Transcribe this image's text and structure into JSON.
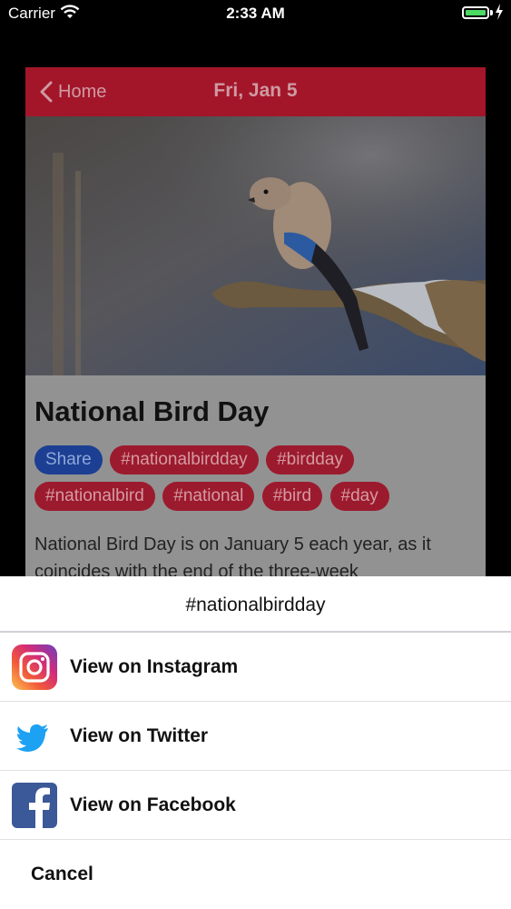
{
  "status_bar": {
    "carrier": "Carrier",
    "time": "2:33 AM",
    "battery_color": "#4cd964"
  },
  "nav": {
    "back_label": "Home",
    "title": "Fri, Jan 5"
  },
  "article": {
    "headline": "National Bird Day",
    "share_label": "Share",
    "tags": [
      "#nationalbirdday",
      "#birdday",
      "#nationalbird",
      "#national",
      "#bird",
      "#day"
    ],
    "description": "National Bird Day is on January 5 each year, as it coincides with the end of the three-week"
  },
  "action_sheet": {
    "title": "#nationalbirdday",
    "actions": [
      {
        "label": "View on Instagram",
        "icon": "instagram-icon"
      },
      {
        "label": "View on Twitter",
        "icon": "twitter-icon"
      },
      {
        "label": "View on Facebook",
        "icon": "facebook-icon"
      }
    ],
    "cancel_label": "Cancel"
  },
  "colors": {
    "nav_bar": "#a3162a",
    "tag": "#9c1a2d",
    "share": "#1c3f93",
    "twitter": "#1da1f2",
    "facebook": "#3b5998"
  }
}
